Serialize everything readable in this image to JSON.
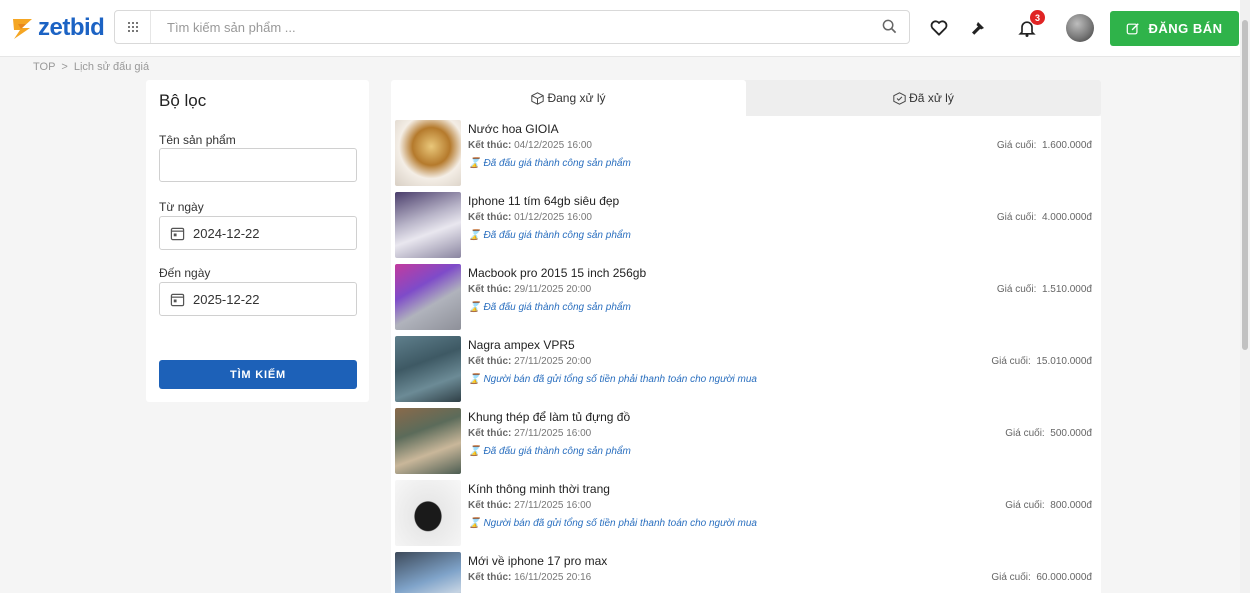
{
  "header": {
    "logo_text": "zetbid",
    "search_placeholder": "Tìm kiếm sản phẩm ...",
    "notification_count": "3",
    "sell_button": "ĐĂNG BÁN"
  },
  "breadcrumb": {
    "home": "TOP",
    "separator": ">",
    "current": "Lịch sử đấu giá"
  },
  "filter": {
    "title": "Bộ lọc",
    "product_name_label": "Tên sản phẩm",
    "product_name_value": "",
    "from_label": "Từ ngày",
    "from_value": "2024-12-22",
    "to_label": "Đến ngày",
    "to_value": "2025-12-22",
    "search_button": "TÌM KIẾM"
  },
  "tabs": [
    {
      "label": "Đang xử lý",
      "active": true
    },
    {
      "label": "Đã xử lý",
      "active": false
    }
  ],
  "items": [
    {
      "name": "Nước hoa GIOIA",
      "end_label": "Kết thúc:",
      "end_time": "04/12/2025 16:00",
      "status": "Đã đấu giá thành công sản phẩm",
      "price_label": "Giá cuối:",
      "price": "1.600.000đ"
    },
    {
      "name": "Iphone 11 tím 64gb siêu đẹp",
      "end_label": "Kết thúc:",
      "end_time": "01/12/2025 16:00",
      "status": "Đã đấu giá thành công sản phẩm",
      "price_label": "Giá cuối:",
      "price": "4.000.000đ"
    },
    {
      "name": "Macbook pro 2015 15 inch 256gb",
      "end_label": "Kết thúc:",
      "end_time": "29/11/2025 20:00",
      "status": "Đã đấu giá thành công sản phẩm",
      "price_label": "Giá cuối:",
      "price": "1.510.000đ"
    },
    {
      "name": "Nagra ampex VPR5",
      "end_label": "Kết thúc:",
      "end_time": "27/11/2025 20:00",
      "status": "Người bán đã gửi tổng số tiền phải thanh toán cho người mua",
      "price_label": "Giá cuối:",
      "price": "15.010.000đ"
    },
    {
      "name": "Khung thép để làm tủ đựng đồ",
      "end_label": "Kết thúc:",
      "end_time": "27/11/2025 16:00",
      "status": "Đã đấu giá thành công sản phẩm",
      "price_label": "Giá cuối:",
      "price": "500.000đ"
    },
    {
      "name": "Kính thông minh thời trang",
      "end_label": "Kết thúc:",
      "end_time": "27/11/2025 16:00",
      "status": "Người bán đã gửi tổng số tiền phải thanh toán cho người mua",
      "price_label": "Giá cuối:",
      "price": "800.000đ"
    },
    {
      "name": "Mới về iphone 17 pro max",
      "end_label": "Kết thúc:",
      "end_time": "16/11/2025 20:16",
      "status": "",
      "price_label": "Giá cuối:",
      "price": "60.000.000đ"
    }
  ],
  "colors": {
    "brand_blue": "#1c63c4",
    "sell_green": "#2fb34a",
    "status_blue": "#2a6fbf",
    "search_btn": "#1d61b8"
  }
}
